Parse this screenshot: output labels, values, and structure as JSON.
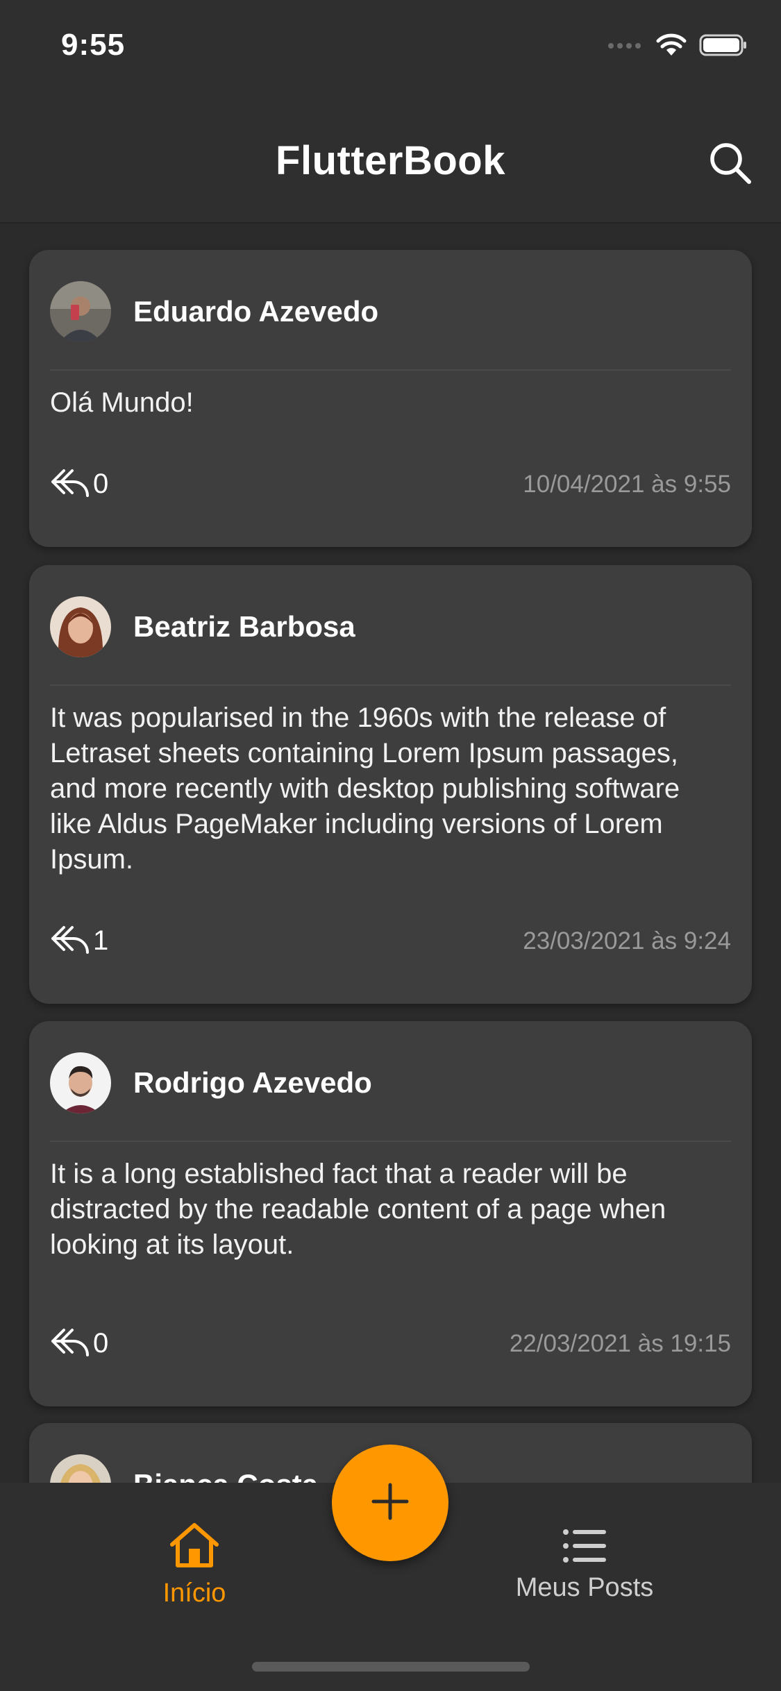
{
  "status_bar": {
    "time": "9:55"
  },
  "app_bar": {
    "title": "FlutterBook"
  },
  "posts": [
    {
      "author": "Eduardo Azevedo",
      "text": "Olá Mundo!",
      "replies": "0",
      "date": "10/04/2021 às 9:55"
    },
    {
      "author": "Beatriz Barbosa",
      "text": "It was popularised in the 1960s with the release of Letraset sheets containing Lorem Ipsum passages, and more recently with desktop publishing software like Aldus PageMaker including versions of Lorem Ipsum.",
      "replies": "1",
      "date": "23/03/2021 às 9:24"
    },
    {
      "author": "Rodrigo Azevedo",
      "text": "It is a long established fact that a reader will be distracted by the readable content of a page when looking at its layout.",
      "replies": "0",
      "date": "22/03/2021 às 19:15"
    },
    {
      "author": "Bianca Costa"
    }
  ],
  "bottom_nav": {
    "items": [
      {
        "label": "Início",
        "icon": "home-icon",
        "active": true
      },
      {
        "label": "Meus Posts",
        "icon": "list-icon",
        "active": false
      }
    ]
  },
  "fab": {
    "icon": "plus-icon"
  },
  "colors": {
    "accent": "#ff9800",
    "background": "#2b2b2b",
    "card": "#3e3e3e",
    "muted": "#9a9a9a",
    "inactive": "#cfcfcf"
  }
}
